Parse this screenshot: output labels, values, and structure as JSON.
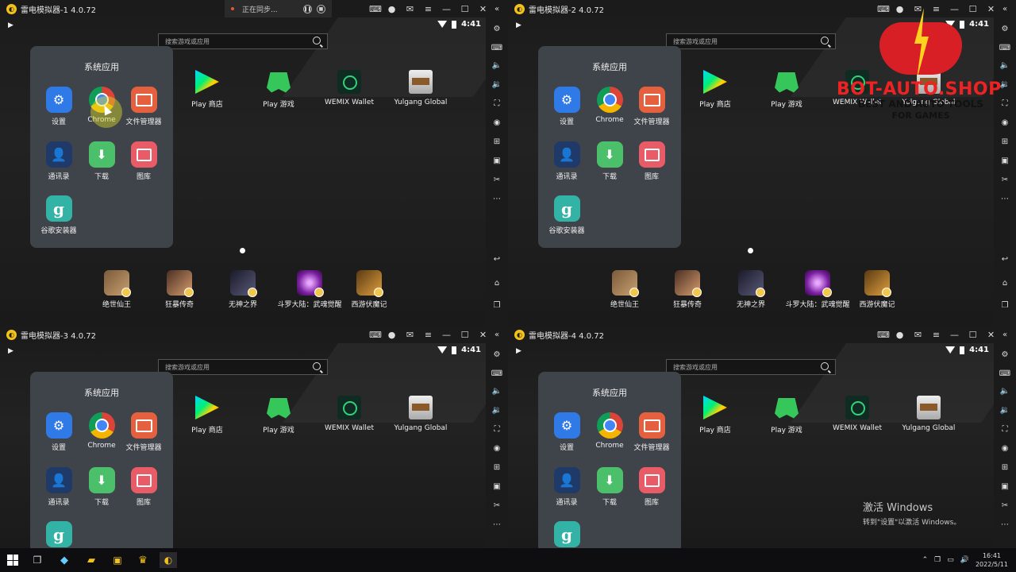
{
  "emulators": [
    {
      "title": "雷电模拟器-1 4.0.72",
      "sync_text": "正在同步..."
    },
    {
      "title": "雷电模拟器-2 4.0.72"
    },
    {
      "title": "雷电模拟器-3 4.0.72"
    },
    {
      "title": "雷电模拟器-4 4.0.72"
    }
  ],
  "status": {
    "time": "4:41"
  },
  "search": {
    "placeholder": "搜索游戏或应用"
  },
  "folder": {
    "title": "系统应用",
    "apps": [
      "设置",
      "Chrome",
      "文件管理器",
      "通讯录",
      "下载",
      "图库",
      "谷歌安装器"
    ]
  },
  "home_apps": [
    "Play 商店",
    "Play 游戏",
    "WEMIX Wallet",
    "Yulgang Global"
  ],
  "dock_apps": [
    "绝世仙王",
    "狂暴传奇",
    "无神之界",
    "斗罗大陆：武魂觉醒",
    "西游伏魔记"
  ],
  "watermark": {
    "brand": "BOT-AUTO.SHOP",
    "line1": "BEST AND AUTO TOOLS",
    "line2": "FOR GAMES"
  },
  "windows_activation": {
    "line1": "激活 Windows",
    "line2": "转到\"设置\"以激活 Windows。"
  },
  "taskbar": {
    "time": "16:41",
    "date": "2022/5/11"
  },
  "colors": {
    "settings": "#2f7ae6",
    "files": "#e4603f",
    "download": "#4cbf6b",
    "gallery": "#e95b66",
    "ginstall": "#33b3a6"
  }
}
